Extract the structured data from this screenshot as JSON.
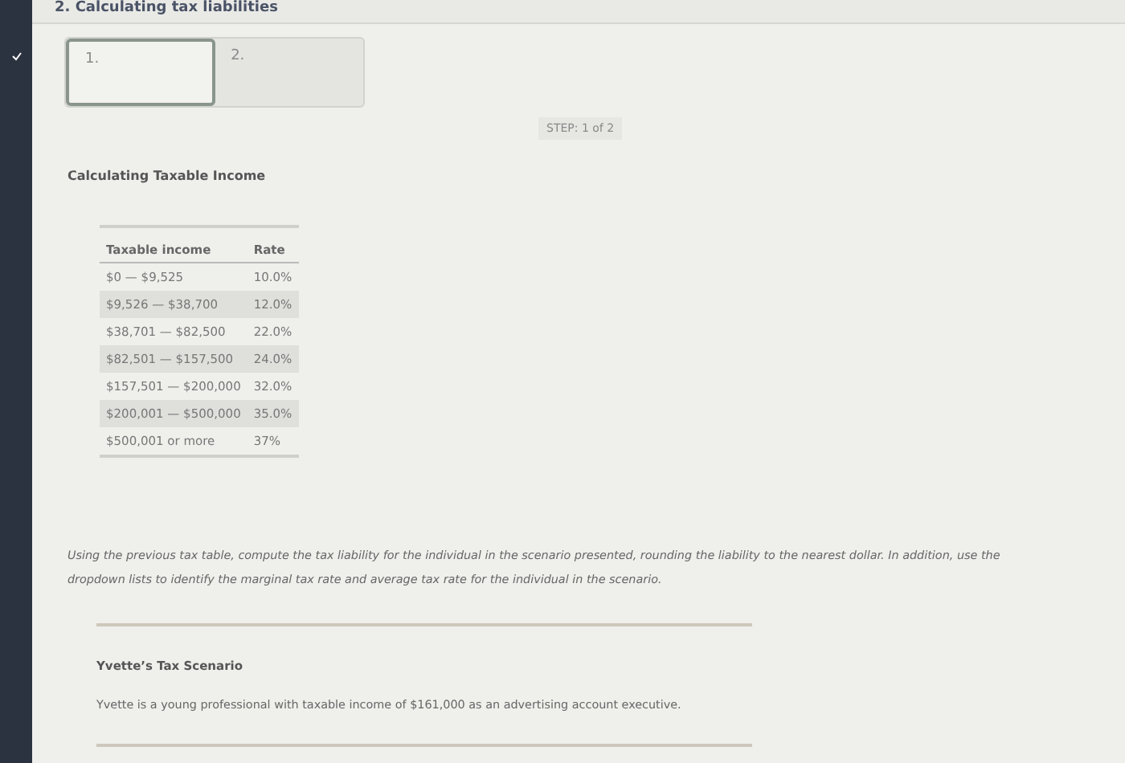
{
  "heading": "2. Calculating tax liabilities",
  "steps": [
    {
      "label": "1.",
      "selected": true
    },
    {
      "label": "2.",
      "selected": false
    }
  ],
  "step_indicator": "STEP: 1 of 2",
  "section_title": "Calculating Taxable Income",
  "table": {
    "columns": [
      "Taxable income",
      "Rate"
    ],
    "rows": [
      [
        "$0 — $9,525",
        "10.0%"
      ],
      [
        "$9,526 — $38,700",
        "12.0%"
      ],
      [
        "$38,701 — $82,500",
        "22.0%"
      ],
      [
        "$82,501 — $157,500",
        "24.0%"
      ],
      [
        "$157,501 — $200,000",
        "32.0%"
      ],
      [
        "$200,001 — $500,000",
        "35.0%"
      ],
      [
        "$500,001 or more",
        "37%"
      ]
    ]
  },
  "instructions": "Using the previous tax table, compute the tax liability for the individual in the scenario presented, rounding the liability to the nearest dollar. In addition, use the dropdown lists to identify the marginal tax rate and average tax rate for the individual in the scenario.",
  "scenario": {
    "title": "Yvette’s Tax Scenario",
    "text": "Yvette is a young professional with taxable income of $161,000 as an advertising account executive."
  }
}
